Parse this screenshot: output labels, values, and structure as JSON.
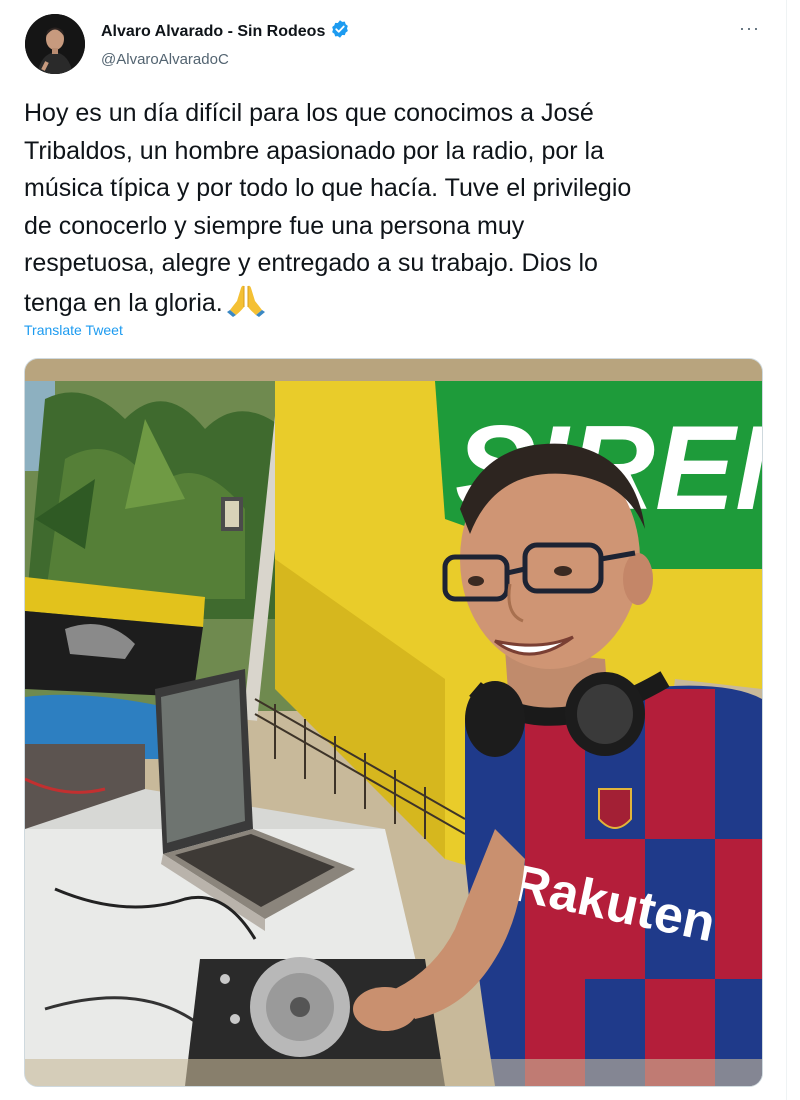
{
  "tweet": {
    "author": {
      "display_name": "Alvaro Alvarado - Sin Rodeos",
      "handle": "@AlvaroAlvaradoC",
      "verified": true,
      "avatar_icon": "profile-photo"
    },
    "more_label": "···",
    "text": "Hoy es un día difícil para los que conocimos a José\nTribaldos, un hombre apasionado por la radio, por la\nmúsica típica y por todo lo que hacía. Tuve el privilegio\nde conocerlo y siempre fue una persona muy\nrespetuosa, alegre y entregado a su trabajo. Dios lo\ntenga en la gloria.",
    "emoji": "folded-hands-emoji",
    "translate_label": "Translate Tweet",
    "photo": {
      "subject": "man-with-headphones-at-dj-booth",
      "banner_text": "SIREN",
      "jersey_text": "Rakuten"
    }
  },
  "colors": {
    "link_blue": "#1d9bf0",
    "verified_blue": "#1d9bf0",
    "text": "#0f1419",
    "secondary_text": "#536471"
  }
}
